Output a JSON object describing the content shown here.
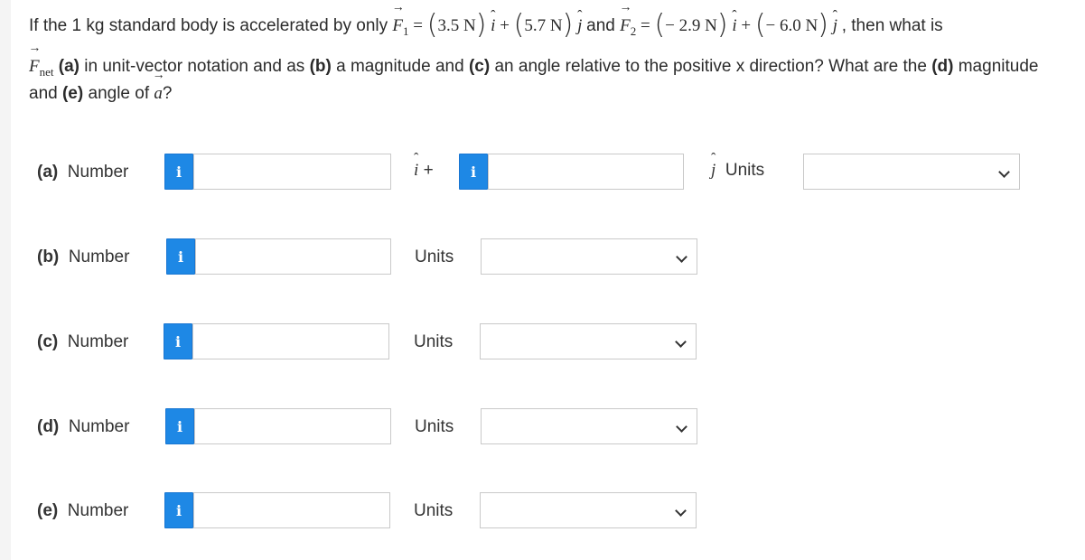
{
  "question": {
    "p1": "If the 1 kg standard body is accelerated by only",
    "F": "F",
    "sub1": "1",
    "eq": "=",
    "v1": "3.5 N",
    "i": "i",
    "plus": "+",
    "v2": "5.7 N",
    "j": "j",
    "and": "and",
    "sub2": "2",
    "v3": "− 2.9 N",
    "v4": "− 6.0 N",
    "then": ", then what is",
    "net": "net",
    "a_label": "(a)",
    "p2a": " in unit-vector notation and as ",
    "b_label": "(b)",
    "p2b": " a magnitude and ",
    "c_label": "(c)",
    "p2c": " an angle relative to the positive x direction? What are the ",
    "d_label": "(d)",
    "p2d": " magnitude",
    "and2": "and ",
    "e_label": "(e)",
    "p3": " angle of ",
    "avec": "a",
    "qmark": "?"
  },
  "rows": [
    {
      "label": "(a)",
      "number": "Number",
      "i_glyph": "i"
    },
    {
      "label": "(b)",
      "number": "Number",
      "i_glyph": "i"
    },
    {
      "label": "(c)",
      "number": "Number",
      "i_glyph": "i"
    },
    {
      "label": "(d)",
      "number": "Number",
      "i_glyph": "i"
    },
    {
      "label": "(e)",
      "number": "Number",
      "i_glyph": "i"
    }
  ],
  "units_label": "Units",
  "ihat_plus": "+",
  "ihat": "i",
  "jhat": "j",
  "colors": {
    "info_button": "#1e88e5"
  }
}
